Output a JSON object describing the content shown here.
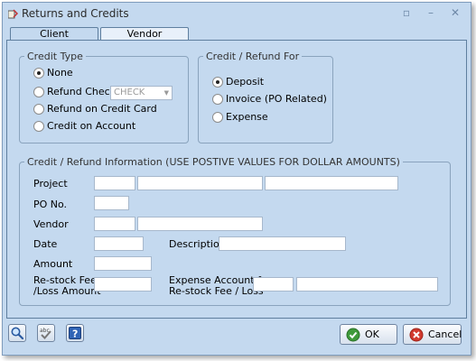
{
  "window": {
    "title": "Returns and Credits"
  },
  "tabs": [
    "Client",
    "Vendor"
  ],
  "credit_type": {
    "legend": "Credit Type",
    "options": [
      "None",
      "Refund Check:",
      "Refund on Credit Card",
      "Credit on Account"
    ],
    "selected": "None",
    "check_combo_value": "CHECK"
  },
  "credit_for": {
    "legend": "Credit / Refund For",
    "options": [
      "Deposit",
      "Invoice (PO Related)",
      "Expense"
    ],
    "selected": "Deposit"
  },
  "info": {
    "legend": "Credit / Refund Information (USE POSTIVE VALUES FOR DOLLAR AMOUNTS)",
    "project_label": "Project",
    "po_label": "PO No.",
    "vendor_label": "Vendor",
    "date_label": "Date",
    "description_label": "Description",
    "amount_label": "Amount",
    "restock_label_1": "Re-stock Fee",
    "restock_label_2": "/Loss Amount",
    "expense_label_1": "Expense Account for",
    "expense_label_2": "Re-stock Fee / Loss"
  },
  "buttons": {
    "ok": "OK",
    "cancel": "Cancel"
  }
}
